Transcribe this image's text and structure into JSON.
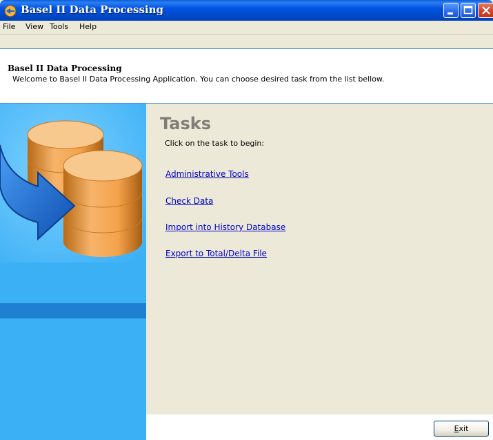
{
  "window": {
    "title": "Basel II Data Processing"
  },
  "menu": {
    "file": "File",
    "view": "View",
    "tools": "Tools",
    "help": "Help"
  },
  "header": {
    "title": "Basel II Data Processing",
    "subtitle": "Welcome to Basel II Data Processing Application. You can choose desired task from the list bellow."
  },
  "tasks": {
    "title": "Tasks",
    "subtitle": "Click on the task to begin:",
    "items": [
      {
        "label": "Administrative Tools"
      },
      {
        "label": "Check Data"
      },
      {
        "label": "Import into History Database"
      },
      {
        "label": "Export to Total/Delta File"
      }
    ]
  },
  "footer": {
    "exit_mnemonic": "E",
    "exit_rest": "xit"
  },
  "colors": {
    "titlebar": "#0054e3",
    "link": "#0000cc",
    "left_panel": "#3cb0f5",
    "header_border": "#4f8fd6"
  },
  "icons": [
    "app-icon",
    "minimize-icon",
    "maximize-icon",
    "close-icon",
    "database-arrow-illustration"
  ]
}
